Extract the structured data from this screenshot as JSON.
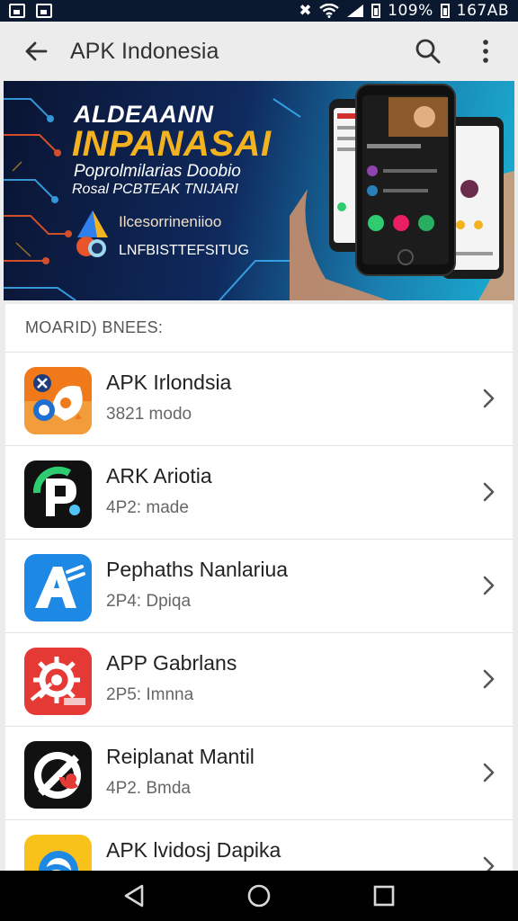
{
  "status_bar": {
    "battery_text": "109%",
    "clock": "167AB"
  },
  "app_bar": {
    "title": "APK Indonesia",
    "back_icon": "arrow-left-icon",
    "search_icon": "search-icon",
    "more_icon": "more-vertical-icon"
  },
  "banner": {
    "title_line1": "ALDEAANN",
    "title_line2": "INPANASAI",
    "subtitle_line1": "Poprolmilarias Doobio",
    "subtitle_line2": "Rosal PCBTEAK TNIJARI",
    "brand": "Ilcesorrineniioo",
    "tagline": "LNFBISTTEFSITUG"
  },
  "list": {
    "section_header": "MOARID) BNEES:",
    "items": [
      {
        "name": "APK Irlondsia",
        "meta": "3821 modo",
        "icon": "orange-game-icon",
        "color": "#f07a1a"
      },
      {
        "name": "ARK Ariotia",
        "meta": "4P2: made",
        "icon": "p-letter-icon",
        "color": "#111111"
      },
      {
        "name": "Pephaths Nanlariua",
        "meta": "2P4: Dpiqa",
        "icon": "a-letter-icon",
        "color": "#1e88e5"
      },
      {
        "name": "APP Gabrlans",
        "meta": "2P5: Imnna",
        "icon": "gear-icon",
        "color": "#e53935"
      },
      {
        "name": "Reiplanat Mantil",
        "meta": "4P2. Bmda",
        "icon": "block-icon",
        "color": "#111111"
      },
      {
        "name": "APK lvidosj Dapika",
        "meta": "",
        "icon": "swirl-icon",
        "color": "#f9c21b"
      }
    ]
  },
  "nav_bar": {
    "back": "nav-back-icon",
    "home": "nav-home-icon",
    "recents": "nav-recents-icon"
  }
}
